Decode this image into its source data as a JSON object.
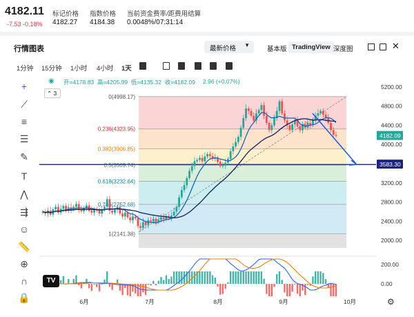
{
  "ticker": {
    "last_price": "4182.11",
    "change": "-7.53 -0.18%",
    "mark_label": "标记价格",
    "mark_value": "4182.27",
    "index_label": "指数价格",
    "index_value": "4184.38",
    "funding_label": "当前资金费率/距费用结算",
    "funding_value": "0.0048%/07:31:14"
  },
  "header": {
    "title": "行情图表",
    "price_type": "最新价格",
    "views": [
      "基本版",
      "TradingView",
      "深度图"
    ],
    "active_view": "TradingView"
  },
  "intervals": [
    "1分钟",
    "15分钟",
    "1小时",
    "4小时",
    "1天"
  ],
  "active_interval": "1天",
  "legend": {
    "ohlc": "开=4178.83  高=4205.99  低=4135.32  收=4182.09",
    "change": "2.96 (+0.07%)",
    "count": "3"
  },
  "fib": {
    "levels": [
      "0(4998.17)",
      "0.236(4323.95)",
      "0.382(3906.85)",
      "0.5(3569.74)",
      "0.618(3232.64)",
      "0.786(2752.68)",
      "1(2141.38)"
    ],
    "ratios": [
      0,
      0.236,
      0.382,
      0.5,
      0.618,
      0.786,
      1
    ],
    "prices": [
      4998.17,
      4323.95,
      3906.85,
      3569.74,
      3232.64,
      2752.68,
      2141.38
    ],
    "colors": [
      "#fbd4d6",
      "#fde3cc",
      "#fdf0cc",
      "#d9efd9",
      "#cdeef0",
      "#d2e9f6",
      "#e2e2e2",
      "#d8e0fb"
    ]
  },
  "price_axis": {
    "ticks": [
      "5200.00",
      "4800.00",
      "4400.00",
      "4000.00",
      "3600.00",
      "3200.00",
      "2800.00",
      "2400.00",
      "2000.00"
    ],
    "last_tag": "4182.09",
    "hline_tag": "3583.30",
    "osc_ticks": [
      "200.00",
      "0.00"
    ]
  },
  "time_axis": [
    "6月",
    "7月",
    "8月",
    "9月",
    "10月"
  ],
  "colors": {
    "up": "#26a69a",
    "down": "#ef5350",
    "ma_fast": "#1565c0",
    "ma_slow": "#0d1f5c",
    "hline": "#1a237e",
    "osc_fast": "#2962ff",
    "osc_slow": "#f57c00"
  },
  "chart_data": {
    "type": "candlestick",
    "x_range": [
      "2024-05-15",
      "2024-10-22"
    ],
    "y_range": [
      1800,
      5400
    ],
    "ohlc_latest": {
      "open": 4178.83,
      "high": 4205.99,
      "low": 4135.32,
      "close": 4182.09
    },
    "closes": [
      2600,
      2560,
      2620,
      2540,
      2650,
      2700,
      2580,
      2660,
      2720,
      2620,
      2690,
      2640,
      2700,
      2760,
      2640,
      2610,
      2680,
      2730,
      2620,
      2580,
      2650,
      2620,
      2560,
      2640,
      2700,
      2860,
      2620,
      2580,
      2640,
      2700,
      2560,
      2500,
      2580,
      2480,
      2420,
      2500,
      2460,
      2300,
      2260,
      2380,
      2320,
      2420,
      2400,
      2450,
      2380,
      2430,
      2480,
      2440,
      2500,
      2470,
      2520,
      2600,
      2700,
      2900,
      3050,
      3150,
      3300,
      3450,
      3550,
      3650,
      3680,
      3720,
      3650,
      3750,
      3800,
      3760,
      3700,
      3720,
      3640,
      3550,
      3560,
      3620,
      3700,
      3860,
      3960,
      4050,
      4160,
      4350,
      4550,
      4750,
      4700,
      4600,
      4500,
      4650,
      4720,
      4820,
      4600,
      4450,
      4300,
      4400,
      4550,
      4700,
      4900,
      4650,
      4500,
      4400,
      4300,
      4420,
      4500,
      4380,
      4300,
      4420,
      4350,
      4450,
      4400,
      4500,
      4600,
      4650,
      4700,
      4620,
      4550,
      4450,
      4300,
      4200,
      4182
    ]
  }
}
